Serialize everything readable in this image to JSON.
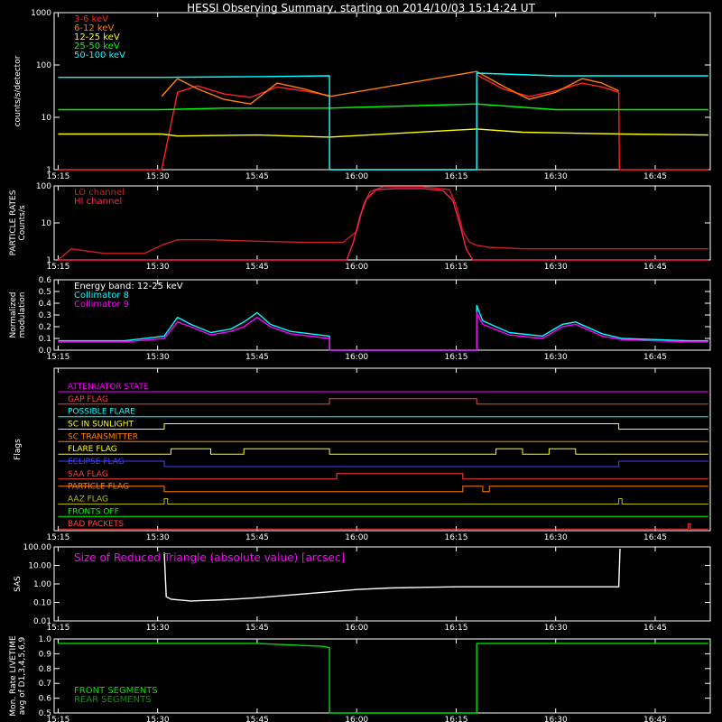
{
  "title": "HESSI Observing Summary, starting on 2014/10/03 15:14:24 UT",
  "time_ticks": [
    "15:15",
    "15:30",
    "15:45",
    "16:00",
    "16:15",
    "16:30",
    "16:45"
  ],
  "chart_data": [
    {
      "id": "count-rates",
      "type": "line",
      "ylabel": "counts/s/detector",
      "yscale": "log",
      "ylim": [
        1,
        1000
      ],
      "yticks": [
        "1",
        "10",
        "100",
        "1000"
      ],
      "legend": [
        {
          "name": "3-6 keV",
          "color": "#ff2020"
        },
        {
          "name": "6-12 keV",
          "color": "#ff8000"
        },
        {
          "name": "12-25 keV",
          "color": "#ffff00"
        },
        {
          "name": "25-50 keV",
          "color": "#00ff00"
        },
        {
          "name": "50-100 keV",
          "color": "#00ffff"
        }
      ],
      "series": [
        {
          "name": "3-6 keV",
          "color": "#ff2020",
          "x": [
            15.0,
            30.6,
            33,
            36,
            40,
            44,
            48,
            52,
            56,
            55.9,
            55.9,
            78.1,
            78.1,
            82,
            86,
            90,
            94,
            97,
            99.5,
            99.6,
            113
          ],
          "y": [
            1,
            1,
            30,
            40,
            28,
            24,
            38,
            32,
            26,
            26,
            1,
            1,
            65,
            35,
            25,
            32,
            45,
            38,
            30,
            1,
            1
          ]
        },
        {
          "name": "6-12 keV",
          "color": "#ff8000",
          "x": [
            30.6,
            33,
            36,
            40,
            44,
            48,
            52,
            56,
            55.9,
            78.1,
            82,
            86,
            90,
            94,
            97,
            99.5
          ],
          "y": [
            25,
            55,
            35,
            22,
            18,
            45,
            35,
            25,
            25,
            75,
            40,
            22,
            30,
            55,
            45,
            32
          ]
        },
        {
          "name": "12-25 keV",
          "color": "#ffff00",
          "x": [
            15.0,
            30.6,
            33,
            45,
            55.9,
            78.1,
            85,
            100,
            113
          ],
          "y": [
            4.8,
            4.8,
            4.4,
            4.6,
            4.2,
            6.0,
            5.2,
            4.8,
            4.6
          ]
        },
        {
          "name": "25-50 keV",
          "color": "#00ff00",
          "x": [
            15.0,
            30.6,
            40,
            55.9,
            78.1,
            90,
            100,
            113
          ],
          "y": [
            14,
            14,
            15,
            15,
            18,
            14,
            14,
            14
          ]
        },
        {
          "name": "50-100 keV",
          "color": "#00ffff",
          "x": [
            15.0,
            30.6,
            45,
            55.9,
            55.9,
            78.1,
            78.1,
            90,
            113
          ],
          "y": [
            58,
            58,
            60,
            62,
            1,
            1,
            70,
            62,
            62
          ]
        }
      ]
    },
    {
      "id": "particle-rates",
      "type": "line",
      "ylabel": "PARTICLE RATES\nCounts/s",
      "yscale": "log",
      "ylim": [
        1,
        100
      ],
      "yticks": [
        "1",
        "10",
        "100"
      ],
      "legend": [
        {
          "name": "LO channel",
          "color": "#cc2020"
        },
        {
          "name": "HI channel",
          "color": "#ff2050"
        }
      ],
      "series": [
        {
          "name": "LO channel",
          "color": "#cc2020",
          "x": [
            15.0,
            17,
            22,
            28,
            30.6,
            33,
            38,
            45,
            52,
            56,
            58,
            60,
            61,
            62,
            64,
            66,
            70,
            74,
            75,
            76,
            77,
            78,
            80,
            85,
            90,
            95,
            100,
            105,
            110,
            113
          ],
          "y": [
            1,
            2,
            1.5,
            1.5,
            2.5,
            3.5,
            3.5,
            3.2,
            3,
            3,
            3,
            6,
            30,
            70,
            95,
            95,
            95,
            80,
            30,
            6,
            3,
            2.5,
            2.2,
            2,
            2,
            2,
            2,
            2,
            2,
            2
          ]
        },
        {
          "name": "HI channel",
          "color": "#ff2050",
          "x": [
            15.0,
            58.5,
            59.5,
            60.5,
            61.5,
            63,
            66,
            70,
            73,
            74.5,
            75.5,
            76.5,
            77.5,
            113
          ],
          "y": [
            1,
            1,
            3,
            15,
            45,
            80,
            85,
            85,
            75,
            40,
            10,
            2,
            1,
            1
          ]
        }
      ]
    },
    {
      "id": "modulation",
      "type": "line",
      "ylabel": "Normalized\nmodulation",
      "ylim": [
        0,
        0.6
      ],
      "yticks": [
        "0.0",
        "0.1",
        "0.2",
        "0.3",
        "0.4",
        "0.5",
        "0.6"
      ],
      "legend": [
        {
          "name": "Energy band: 12-25 keV",
          "color": "#ffffff"
        },
        {
          "name": "Collimator 8",
          "color": "#00ffff"
        },
        {
          "name": "Collimator 9",
          "color": "#ff00ff"
        }
      ],
      "series": [
        {
          "name": "Collimator 8",
          "color": "#00ffff",
          "x": [
            15.0,
            25,
            31,
            33,
            35,
            38,
            41,
            43,
            45,
            47,
            50,
            55.9,
            55.9,
            78.1,
            78.1,
            79,
            83,
            88,
            91,
            93,
            97,
            100,
            110,
            113
          ],
          "y": [
            0.08,
            0.08,
            0.12,
            0.28,
            0.22,
            0.15,
            0.18,
            0.24,
            0.32,
            0.22,
            0.16,
            0.12,
            0,
            0,
            0.38,
            0.25,
            0.15,
            0.12,
            0.22,
            0.24,
            0.14,
            0.1,
            0.08,
            0.08
          ]
        },
        {
          "name": "Collimator 9",
          "color": "#ff00ff",
          "x": [
            15.0,
            25,
            31,
            33,
            35,
            38,
            41,
            43,
            45,
            47,
            50,
            55.9,
            55.9,
            78.1,
            78.1,
            79,
            83,
            88,
            91,
            93,
            97,
            100,
            110,
            113
          ],
          "y": [
            0.07,
            0.07,
            0.1,
            0.24,
            0.2,
            0.13,
            0.16,
            0.2,
            0.28,
            0.2,
            0.14,
            0.1,
            0,
            0,
            0.32,
            0.22,
            0.13,
            0.1,
            0.2,
            0.22,
            0.12,
            0.09,
            0.07,
            0.07
          ]
        }
      ]
    },
    {
      "id": "flags",
      "type": "line",
      "ylabel": "Flags",
      "rows": [
        {
          "name": "ATTENUATOR STATE",
          "color": "#ff00ff",
          "x": [
            15,
            113
          ],
          "y": [
            0,
            0
          ]
        },
        {
          "name": "GAP FLAG",
          "color": "#ff4040",
          "x": [
            15,
            55.9,
            55.9,
            78.1,
            78.1,
            113
          ],
          "y": [
            0,
            0,
            1,
            1,
            0,
            0
          ]
        },
        {
          "name": "POSSIBLE FLARE",
          "color": "#00ffff",
          "x": [
            15,
            113
          ],
          "y": [
            0,
            0
          ]
        },
        {
          "name": "SC IN SUNLIGHT",
          "color": "#ffff00",
          "x": [
            15,
            31,
            31,
            99.5,
            99.5,
            113
          ],
          "y": [
            0,
            0,
            1,
            1,
            0,
            0
          ]
        },
        {
          "name": "SC TRANSMITTER",
          "color": "#ff8000",
          "x": [
            15,
            113
          ],
          "y": [
            0,
            0
          ]
        },
        {
          "name": "FLARE FLAG",
          "color": "#ffff00",
          "x": [
            15,
            32,
            32,
            38,
            38,
            43,
            43,
            55.9,
            55.9,
            81,
            81,
            85,
            85,
            89,
            89,
            93,
            93,
            113
          ],
          "y": [
            0,
            0,
            1,
            1,
            0,
            0,
            1,
            1,
            0,
            0,
            1,
            1,
            0,
            0,
            1,
            1,
            0,
            0
          ]
        },
        {
          "name": "ECLIPSE FLAG",
          "color": "#4040ff",
          "x": [
            15,
            31,
            31,
            99.5,
            99.5,
            113
          ],
          "y": [
            1,
            1,
            0,
            0,
            1,
            1
          ]
        },
        {
          "name": "SAA FLAG",
          "color": "#ff4040",
          "x": [
            15,
            57,
            57,
            76,
            76,
            113
          ],
          "y": [
            0,
            0,
            1,
            1,
            0,
            0
          ]
        },
        {
          "name": "PARTICLE FLAG",
          "color": "#ff8000",
          "x": [
            15,
            31,
            31,
            76,
            76,
            79,
            79,
            80,
            80,
            113
          ],
          "y": [
            1,
            1,
            0,
            0,
            1,
            1,
            0,
            0,
            1,
            1
          ]
        },
        {
          "name": "AAZ FLAG",
          "color": "#bbbb00",
          "x": [
            15,
            31,
            31,
            31.5,
            31.5,
            99.5,
            99.5,
            100,
            100,
            113
          ],
          "y": [
            0,
            0,
            1,
            1,
            0,
            0,
            1,
            1,
            0,
            0
          ]
        },
        {
          "name": "FRONTS OFF",
          "color": "#00ff00",
          "x": [
            15,
            113
          ],
          "y": [
            0,
            0
          ]
        },
        {
          "name": "BAD PACKETS",
          "color": "#ff4040",
          "x": [
            15,
            110,
            110,
            110.3,
            110.3,
            113
          ],
          "y": [
            0,
            0,
            1,
            1,
            0,
            0
          ]
        }
      ]
    },
    {
      "id": "sas",
      "type": "line",
      "ylabel": "SAS",
      "yscale": "log",
      "ylim": [
        0.01,
        100
      ],
      "yticks": [
        "0.01",
        "0.10",
        "1.00",
        "10.00",
        "100.00"
      ],
      "annotation": "Size of Reduced Triangle (absolute value) [arcsec]",
      "series": [
        {
          "name": "",
          "color": "#ffffff",
          "x": [
            31.0,
            31.3,
            32,
            35,
            40,
            45,
            50,
            55,
            60,
            65,
            70,
            75,
            80,
            85,
            90,
            95,
            99.5,
            99.7
          ],
          "y": [
            50,
            0.2,
            0.15,
            0.12,
            0.14,
            0.18,
            0.25,
            0.35,
            0.5,
            0.6,
            0.65,
            0.7,
            0.7,
            0.7,
            0.7,
            0.7,
            0.7,
            80
          ]
        }
      ]
    },
    {
      "id": "livetime",
      "type": "line",
      "ylabel": "Mon. Rate LIVETIME\navg of D1,3,4,5,6,9",
      "ylim": [
        0.5,
        1.0
      ],
      "yticks": [
        "0.5",
        "0.6",
        "0.7",
        "0.8",
        "0.9",
        "1.0"
      ],
      "legend": [
        {
          "name": "FRONT SEGMENTS",
          "color": "#00dd00"
        },
        {
          "name": "REAR SEGMENTS",
          "color": "#009900"
        }
      ],
      "series": [
        {
          "name": "FRONT SEGMENTS",
          "color": "#00dd00",
          "x": [
            15.0,
            45,
            55,
            55.9,
            55.9,
            78.1,
            78.1,
            90,
            113
          ],
          "y": [
            0.97,
            0.97,
            0.95,
            0.94,
            0.5,
            0.5,
            0.97,
            0.97,
            0.97
          ]
        }
      ]
    }
  ]
}
